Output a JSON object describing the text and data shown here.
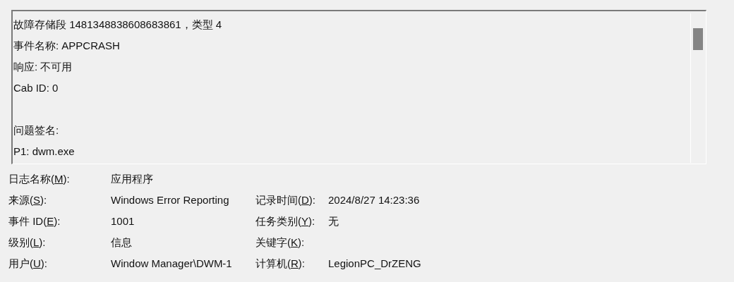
{
  "description_box": {
    "paragraphs": [
      [
        "故障存储段 1481348838608683861，类型 4",
        "事件名称: APPCRASH",
        "响应: 不可用",
        "Cab ID: 0"
      ],
      [
        "问题签名:",
        "P1: dwm.exe"
      ]
    ]
  },
  "properties": [
    {
      "left": {
        "label_parts": [
          "日志名称(",
          "M",
          "):"
        ],
        "value": "应用程序"
      }
    },
    {
      "left": {
        "label_parts": [
          "来源(",
          "S",
          "):"
        ],
        "value": "Windows Error Reporting"
      },
      "right": {
        "label_parts": [
          "记录时间(",
          "D",
          "):"
        ],
        "value": "2024/8/27 14:23:36"
      }
    },
    {
      "left": {
        "label_parts": [
          "事件 ID(",
          "E",
          "):"
        ],
        "value": "1001"
      },
      "right": {
        "label_parts": [
          "任务类别(",
          "Y",
          "):"
        ],
        "value": "无"
      }
    },
    {
      "left": {
        "label_parts": [
          "级别(",
          "L",
          "):"
        ],
        "value": "信息"
      },
      "right": {
        "label_parts": [
          "关键字(",
          "K",
          "):"
        ]
      }
    },
    {
      "left": {
        "label_parts": [
          "用户(",
          "U",
          "):"
        ],
        "value": "Window Manager\\DWM-1"
      },
      "right": {
        "label_parts": [
          "计算机(",
          "R",
          "):"
        ],
        "value": "LegionPC_DrZENG"
      }
    }
  ]
}
